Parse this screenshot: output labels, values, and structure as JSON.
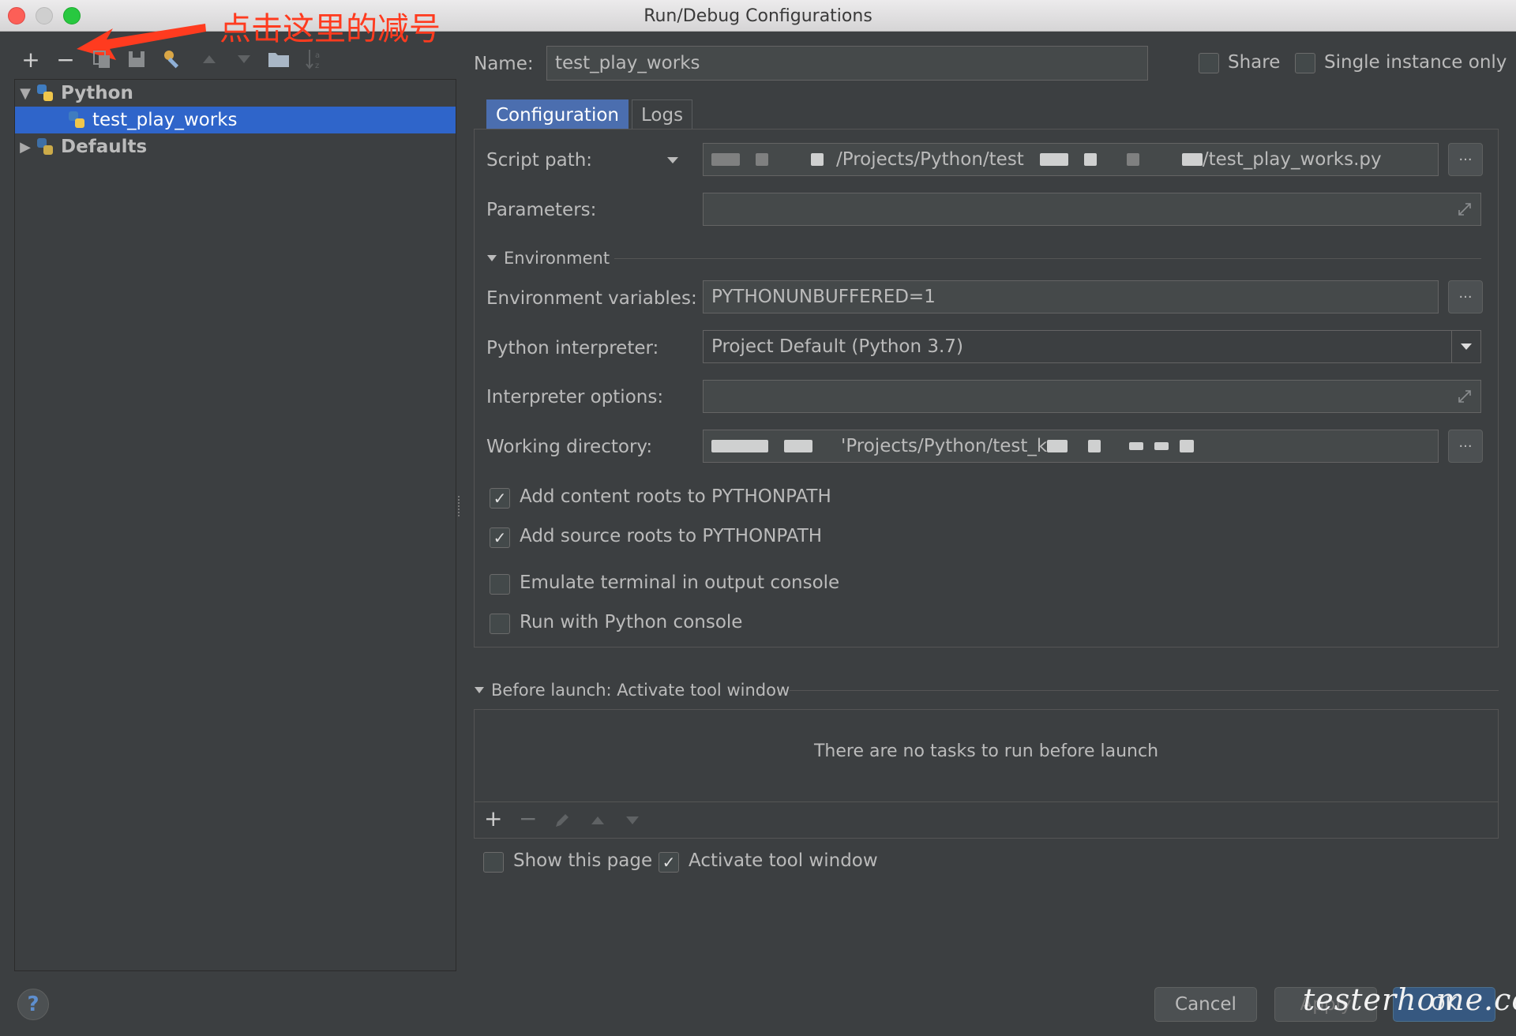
{
  "window": {
    "title": "Run/Debug Configurations"
  },
  "annotation": {
    "text": "点击这里的减号"
  },
  "toolbar": {
    "add": "+",
    "remove": "−"
  },
  "tree": {
    "items": [
      {
        "label": "Python"
      },
      {
        "label": "test_play_works"
      },
      {
        "label": "Defaults"
      }
    ]
  },
  "name_field": {
    "label": "Name:",
    "value": "test_play_works"
  },
  "share": {
    "label": "Share",
    "checked": false
  },
  "single_instance": {
    "label": "Single instance only",
    "checked": false
  },
  "tabs": [
    {
      "label": "Configuration"
    },
    {
      "label": "Logs"
    }
  ],
  "config": {
    "script_path": {
      "label": "Script path:",
      "value_a": "/Projects/Python/test",
      "value_b": "/test_play_works.py"
    },
    "parameters": {
      "label": "Parameters:",
      "value": ""
    },
    "environment_section": "Environment",
    "env_vars": {
      "label": "Environment variables:",
      "value": "PYTHONUNBUFFERED=1"
    },
    "interpreter": {
      "label": "Python interpreter:",
      "value": "Project Default (Python 3.7)"
    },
    "interpreter_options": {
      "label": "Interpreter options:",
      "value": ""
    },
    "working_dir": {
      "label": "Working directory:",
      "value": "'Projects/Python/test_k"
    },
    "checkboxes": [
      {
        "label": "Add content roots to PYTHONPATH",
        "checked": true
      },
      {
        "label": "Add source roots to PYTHONPATH",
        "checked": true
      },
      {
        "label": "Emulate terminal in output console",
        "checked": false
      },
      {
        "label": "Run with Python console",
        "checked": false
      }
    ]
  },
  "before_launch": {
    "title": "Before launch: Activate tool window",
    "empty_text": "There are no tasks to run before launch",
    "show_page": {
      "label": "Show this page",
      "checked": false
    },
    "activate_tool": {
      "label": "Activate tool window",
      "checked": true
    }
  },
  "buttons": {
    "cancel": "Cancel",
    "apply": "Apply",
    "ok": "OK"
  },
  "watermark": "testerhome.com",
  "colors": {
    "accent": "#2f65ca",
    "annotation": "#ff3b1f",
    "background": "#3c3f41"
  }
}
